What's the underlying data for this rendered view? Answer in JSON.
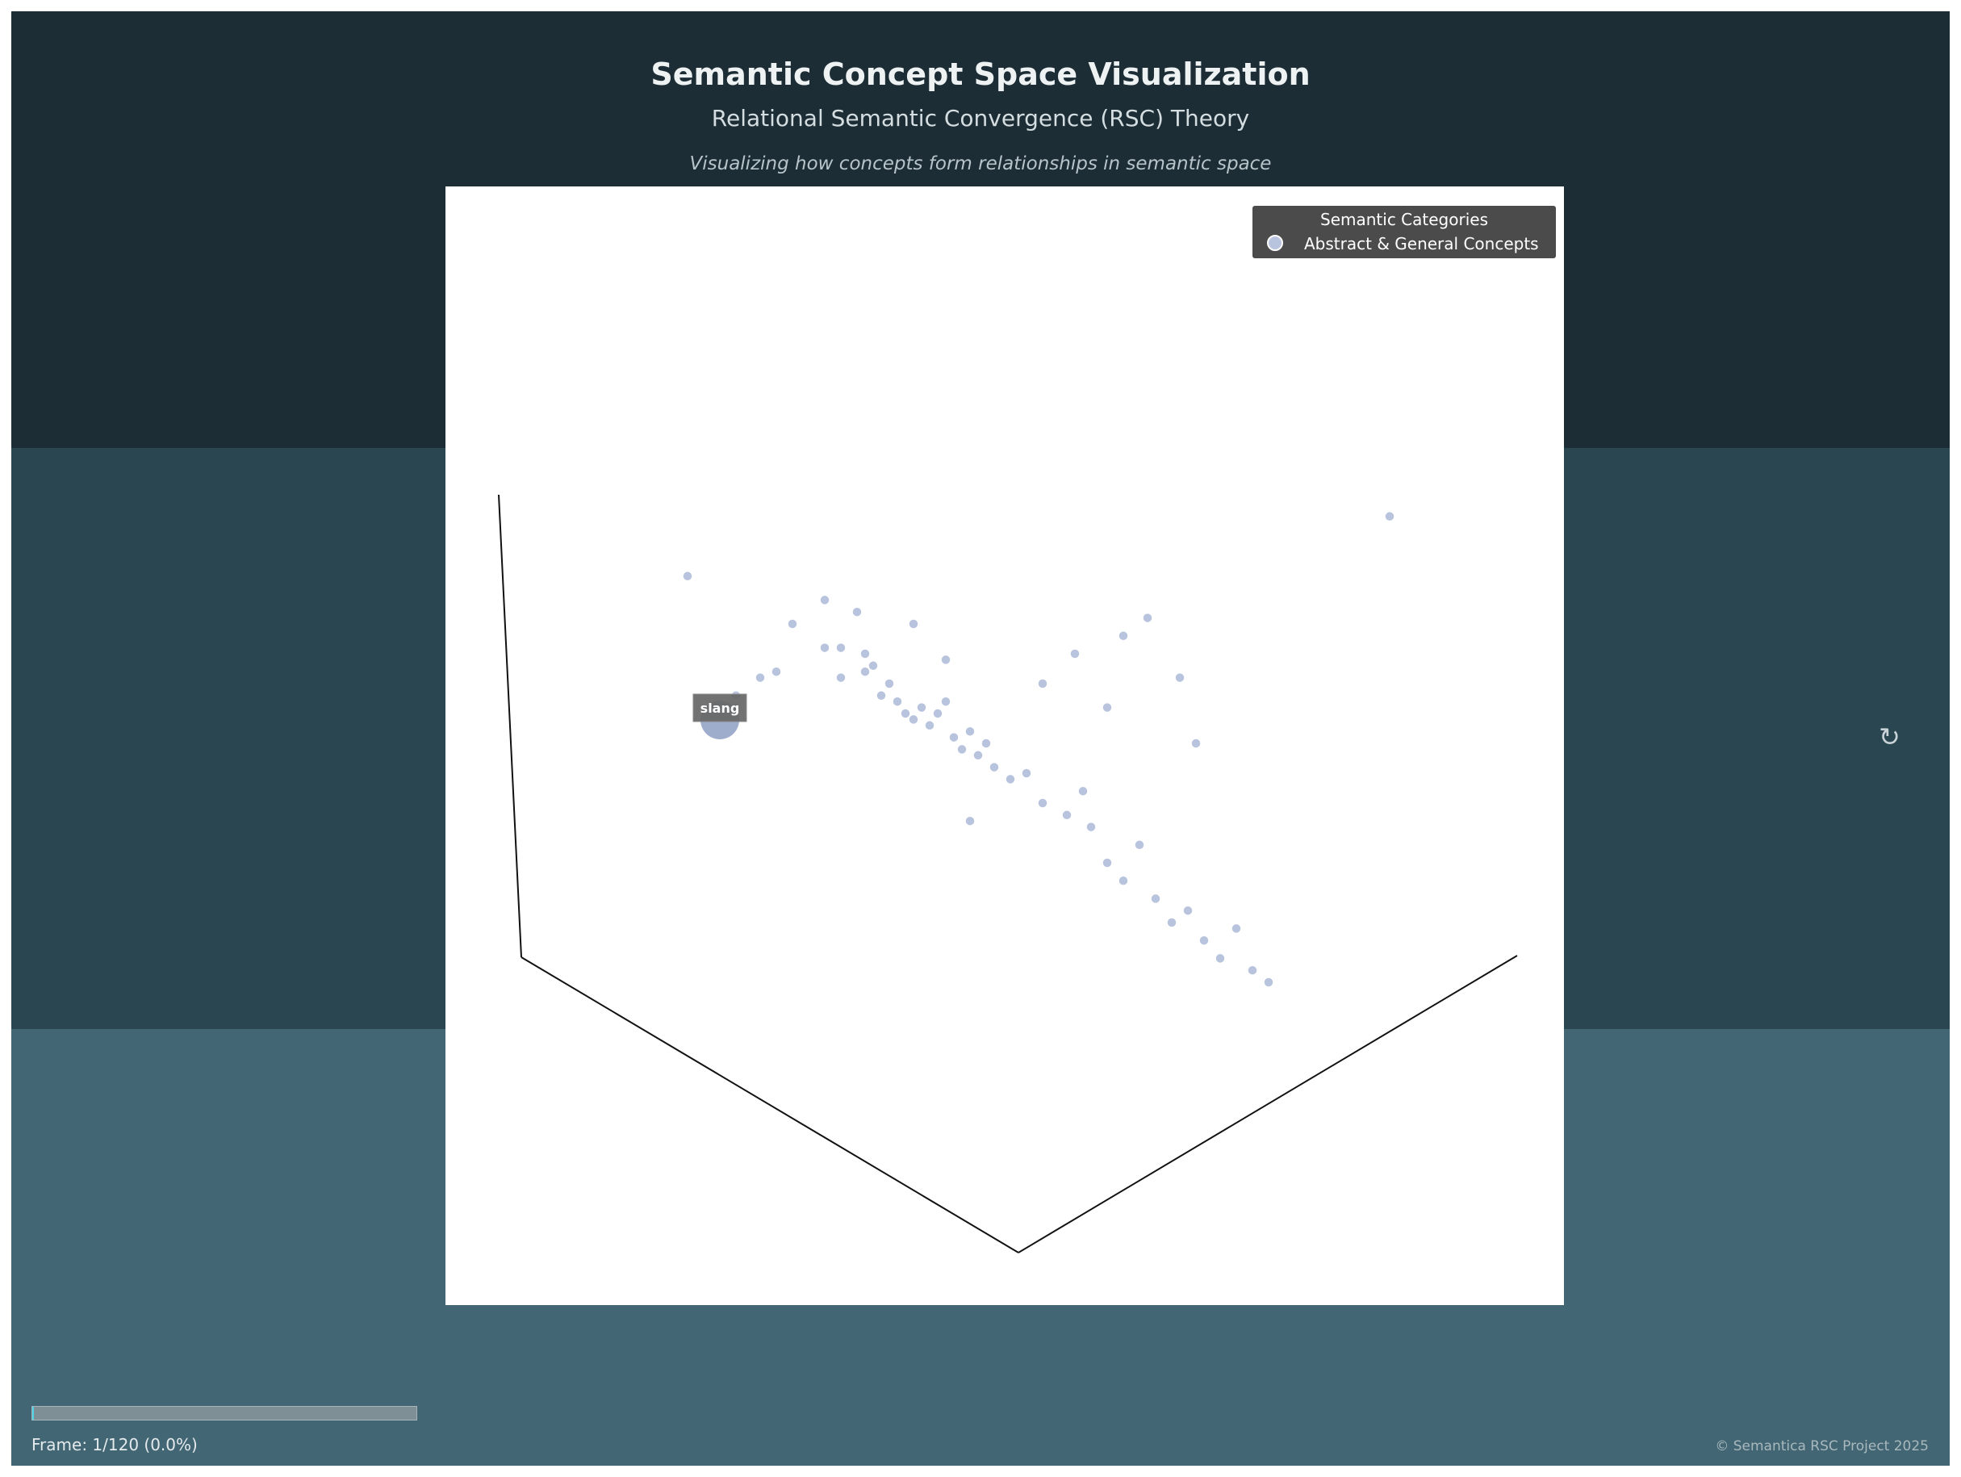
{
  "header": {
    "title": "Semantic Concept Space Visualization",
    "subtitle": "Relational Semantic Convergence (RSC) Theory",
    "tagline": "Visualizing how concepts form relationships in semantic space"
  },
  "footer": {
    "frame_label": "Frame: 1/120 (0.0%)",
    "progress": 0.0,
    "copyright": "© Semantica RSC Project 2025"
  },
  "controls": {
    "rotate_icon": "rotate-icon"
  },
  "colors": {
    "band_top": "#1c2d36",
    "band_mid": "#2a4650",
    "band_bot": "#426674",
    "point": "#b8c3dd",
    "highlight": "#8e9fc4",
    "progress_accent": "#4fd1e6"
  },
  "chart_data": {
    "type": "scatter",
    "projection": "3d",
    "grid": false,
    "legend_placement": "top-right",
    "legend": {
      "title": "Semantic Categories",
      "entries": [
        "Abstract & General Concepts"
      ]
    },
    "series": [
      {
        "name": "Abstract & General Concepts",
        "points": [
          [
            0.08,
            0.78
          ],
          [
            0.21,
            0.7
          ],
          [
            0.29,
            0.72
          ],
          [
            0.36,
            0.7
          ],
          [
            0.4,
            0.64
          ],
          [
            0.19,
            0.62
          ],
          [
            0.17,
            0.61
          ],
          [
            0.14,
            0.58
          ],
          [
            0.25,
            0.66
          ],
          [
            0.27,
            0.61
          ],
          [
            0.27,
            0.66
          ],
          [
            0.3,
            0.65
          ],
          [
            0.3,
            0.62
          ],
          [
            0.31,
            0.63
          ],
          [
            0.32,
            0.58
          ],
          [
            0.33,
            0.6
          ],
          [
            0.34,
            0.57
          ],
          [
            0.35,
            0.55
          ],
          [
            0.36,
            0.54
          ],
          [
            0.37,
            0.56
          ],
          [
            0.38,
            0.53
          ],
          [
            0.39,
            0.55
          ],
          [
            0.4,
            0.57
          ],
          [
            0.41,
            0.51
          ],
          [
            0.42,
            0.49
          ],
          [
            0.43,
            0.52
          ],
          [
            0.44,
            0.48
          ],
          [
            0.45,
            0.5
          ],
          [
            0.46,
            0.46
          ],
          [
            0.48,
            0.44
          ],
          [
            0.5,
            0.45
          ],
          [
            0.52,
            0.4
          ],
          [
            0.55,
            0.38
          ],
          [
            0.57,
            0.42
          ],
          [
            0.58,
            0.36
          ],
          [
            0.6,
            0.3
          ],
          [
            0.62,
            0.27
          ],
          [
            0.64,
            0.33
          ],
          [
            0.66,
            0.24
          ],
          [
            0.68,
            0.2
          ],
          [
            0.7,
            0.22
          ],
          [
            0.72,
            0.17
          ],
          [
            0.74,
            0.14
          ],
          [
            0.76,
            0.19
          ],
          [
            0.78,
            0.12
          ],
          [
            0.8,
            0.1
          ],
          [
            0.25,
            0.74
          ],
          [
            0.43,
            0.37
          ],
          [
            0.52,
            0.6
          ],
          [
            0.56,
            0.65
          ],
          [
            0.6,
            0.56
          ],
          [
            0.62,
            0.68
          ],
          [
            0.65,
            0.71
          ],
          [
            0.69,
            0.61
          ],
          [
            0.71,
            0.5
          ],
          [
            0.95,
            0.88
          ]
        ],
        "highlight": {
          "label": "slang",
          "point": [
            0.12,
            0.55
          ]
        }
      }
    ]
  }
}
